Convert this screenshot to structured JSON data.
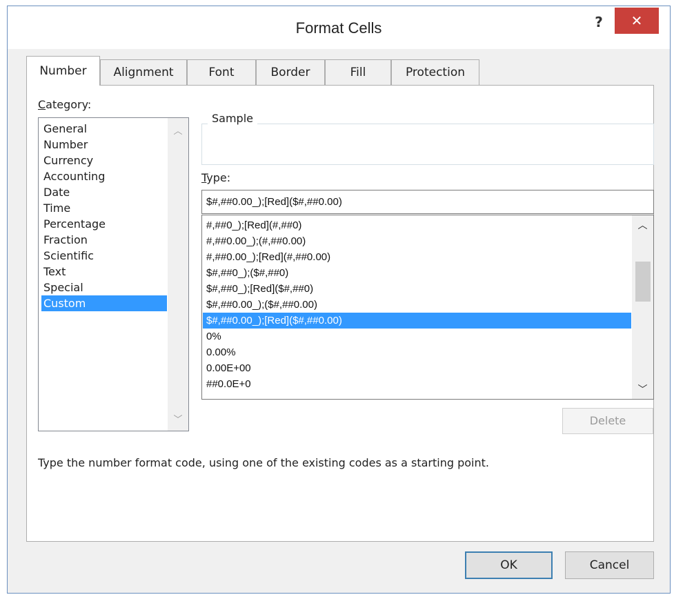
{
  "window": {
    "title": "Format Cells",
    "help_label": "?",
    "close_label": "✕"
  },
  "tabs": [
    {
      "label": "Number",
      "active": true
    },
    {
      "label": "Alignment",
      "active": false
    },
    {
      "label": "Font",
      "active": false
    },
    {
      "label": "Border",
      "active": false
    },
    {
      "label": "Fill",
      "active": false
    },
    {
      "label": "Protection",
      "active": false
    }
  ],
  "category": {
    "label_first": "C",
    "label_rest": "ategory:",
    "items": [
      "General",
      "Number",
      "Currency",
      "Accounting",
      "Date",
      "Time",
      "Percentage",
      "Fraction",
      "Scientific",
      "Text",
      "Special",
      "Custom"
    ],
    "selected": "Custom"
  },
  "sample": {
    "label": "Sample"
  },
  "type": {
    "label_first": "T",
    "label_rest": "ype:",
    "value": "$#,##0.00_);[Red]($#,##0.00)"
  },
  "formats": {
    "items": [
      "#,##0_);[Red](#,##0)",
      "#,##0.00_);(#,##0.00)",
      "#,##0.00_);[Red](#,##0.00)",
      "$#,##0_);($#,##0)",
      "$#,##0_);[Red]($#,##0)",
      "$#,##0.00_);($#,##0.00)",
      "$#,##0.00_);[Red]($#,##0.00)",
      "0%",
      "0.00%",
      "0.00E+00",
      "##0.0E+0"
    ],
    "selected": "$#,##0.00_);[Red]($#,##0.00)"
  },
  "delete_label": "Delete",
  "hint": "Type the number format code, using one of the existing codes as a starting point.",
  "footer": {
    "ok_label": "OK",
    "cancel_label": "Cancel"
  },
  "colors": {
    "selection": "#3399ff",
    "close_button": "#c9403a",
    "dialog_bg": "#f0f0f0"
  }
}
